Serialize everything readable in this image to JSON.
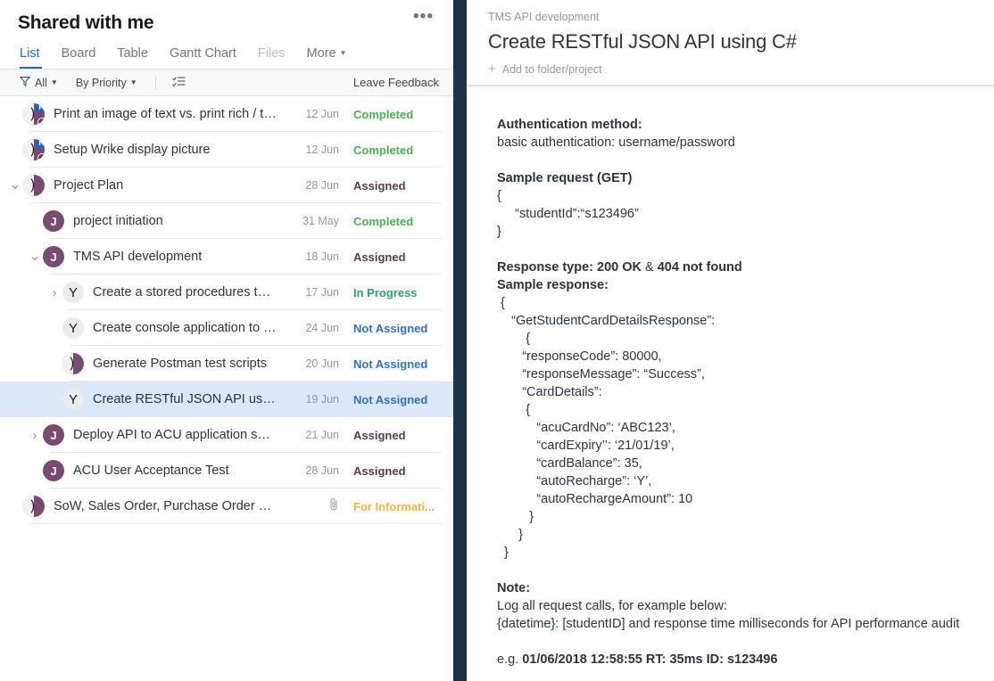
{
  "left": {
    "title": "Shared with me",
    "more_label": "•••",
    "tabs": [
      {
        "label": "List",
        "state": "active"
      },
      {
        "label": "Board",
        "state": "normal"
      },
      {
        "label": "Table",
        "state": "normal"
      },
      {
        "label": "Gantt Chart",
        "state": "normal"
      },
      {
        "label": "Files",
        "state": "dim"
      },
      {
        "label": "More",
        "state": "normal",
        "caret": true
      }
    ],
    "toolbar": {
      "filter_label": "All",
      "filter_icon": "funnel-icon",
      "sort_label": "By Priority",
      "view_icon": "checklist-icon",
      "feedback_label": "Leave Feedback"
    },
    "rows": [
      {
        "indent": 0,
        "twisty": "",
        "avatar": "half-purple-badge",
        "avatar_text": "",
        "title": "Print an image of text vs. print rich / tr...",
        "date": "12 Jun",
        "status": "Completed",
        "status_color": "#4caf50"
      },
      {
        "indent": 0,
        "twisty": "",
        "avatar": "half-purple-badge",
        "avatar_text": "",
        "title": "Setup Wrike display picture",
        "date": "12 Jun",
        "status": "Completed",
        "status_color": "#4caf50"
      },
      {
        "indent": 0,
        "twisty": "v",
        "avatar": "half-purple",
        "avatar_text": "",
        "title": "Project Plan",
        "date": "28 Jun",
        "status": "Assigned",
        "status_color": "#5a3a52"
      },
      {
        "indent": 1,
        "twisty": "",
        "avatar": "j",
        "avatar_text": "J",
        "title": "project initiation",
        "date": "31 May",
        "status": "Completed",
        "status_color": "#4caf50"
      },
      {
        "indent": 1,
        "twisty": "v",
        "avatar": "j",
        "avatar_text": "J",
        "title": "TMS API development",
        "date": "18 Jun",
        "status": "Assigned",
        "status_color": "#5a3a52"
      },
      {
        "indent": 2,
        "twisty": ">",
        "avatar": "y",
        "avatar_text": "Y",
        "title": "Create a stored procedures to retri...",
        "date": "17 Jun",
        "status": "In Progress",
        "status_color": "#2e9e77"
      },
      {
        "indent": 2,
        "twisty": "",
        "avatar": "y",
        "avatar_text": "Y",
        "title": "Create console application to load ...",
        "date": "24 Jun",
        "status": "Not Assigned",
        "status_color": "#2f6fd0"
      },
      {
        "indent": 2,
        "twisty": "",
        "avatar": "half-purple",
        "avatar_text": "",
        "title": "Generate Postman test scripts",
        "date": "20 Jun",
        "status": "Not Assigned",
        "status_color": "#2f6fd0"
      },
      {
        "indent": 2,
        "twisty": "",
        "avatar": "y",
        "avatar_text": "Y",
        "title": "Create RESTful JSON API using C#",
        "date": "19 Jun",
        "status": "Not Assigned",
        "status_color": "#2f6fd0",
        "selected": true
      },
      {
        "indent": 1,
        "twisty": ">",
        "avatar": "j",
        "avatar_text": "J",
        "title": "Deploy API to ACU application server",
        "date": "21 Jun",
        "status": "Assigned",
        "status_color": "#5a3a52"
      },
      {
        "indent": 1,
        "twisty": "",
        "avatar": "j",
        "avatar_text": "J",
        "title": "ACU User Acceptance Test",
        "date": "28 Jun",
        "status": "Assigned",
        "status_color": "#5a3a52"
      },
      {
        "indent": 0,
        "twisty": "",
        "avatar": "half-purple",
        "avatar_text": "",
        "title": "SoW, Sales Order, Purchase Order Docu...",
        "date": "",
        "attachment": true,
        "status": "For Informati...",
        "status_color": "#f5b33c"
      }
    ]
  },
  "right": {
    "breadcrumb": "TMS API development",
    "title": "Create RESTful JSON API using C#",
    "add_folder_label": "Add to folder/project",
    "description": {
      "auth_heading": "Authentication method:",
      "auth_text": "basic authentication: username/password",
      "request_heading": "Sample request (GET)",
      "request_lines": [
        "{",
        "     “studentId”:“s123496”",
        "}"
      ],
      "response_type_label": "Response type: 200 OK",
      "response_type_amp": " & ",
      "response_type_label2": "404 not found",
      "response_heading": "Sample response:",
      "response_lines": [
        " {",
        "    “GetStudentCardDetailsResponse”:",
        "        {",
        "       “responseCode”: 80000,",
        "       “responseMessage”: “Success”,",
        "       “CardDetails”:",
        "        {",
        "           “acuCardNo”: ‘ABC123’,",
        "           “cardExpiry’’: ‘21/01/19’,",
        "           “cardBalance”: 35,",
        "           “autoRecharge”: ‘Y’,",
        "           “autoRechargeAmount”: 10",
        "         }",
        "      }",
        "  }"
      ],
      "note_heading": "Note:",
      "note_line1": "Log all request calls, for example below:",
      "note_line2": "{datetime}: [studentID] and response time milliseconds for API performance audit",
      "example_prefix": "e.g. ",
      "example_value": "01/06/2018 12:58:55 RT: 35ms ID: s123496"
    }
  },
  "colors": {
    "accent": "#1f6fd0",
    "divider_navy": "#1d3349",
    "selection": "#dbe8f7",
    "avatar_purple": "#7a4a72"
  }
}
